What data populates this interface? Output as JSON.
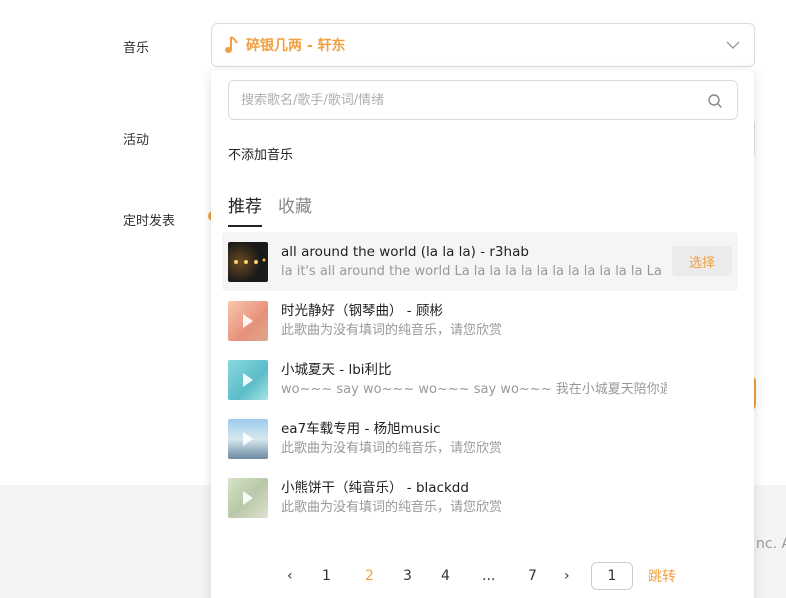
{
  "form": {
    "music_label": "音乐",
    "activity_label": "活动",
    "schedule_label": "定时发表"
  },
  "music_select": {
    "selected": "碎银几两 - 轩东"
  },
  "search": {
    "placeholder": "搜索歌名/歌手/歌词/情绪"
  },
  "no_music": "不添加音乐",
  "tabs": [
    {
      "label": "推荐",
      "active": true
    },
    {
      "label": "收藏",
      "active": false
    }
  ],
  "songs": [
    {
      "title": "all around the world (la la la) - r3hab",
      "sub": " la it's all around the world La la la la la la la la la la la la La la la la la",
      "button": "选择"
    },
    {
      "title": "时光静好（钢琴曲） - 顾彬",
      "sub": "此歌曲为没有填词的纯音乐，请您欣赏"
    },
    {
      "title": "小城夏天 - lbi利比",
      "sub": "wo~~~ say wo~~~ wo~~~ say wo~~~ 我在小城夏天陪你遇见浪漫"
    },
    {
      "title": "ea7车载专用 - 杨旭music",
      "sub": "此歌曲为没有填词的纯音乐，请您欣赏"
    },
    {
      "title": "小熊饼干（纯音乐） - blackdd",
      "sub": "此歌曲为没有填词的纯音乐，请您欣赏"
    }
  ],
  "pagination": {
    "prev": "‹",
    "next": "›",
    "pages": [
      "1",
      "2",
      "3",
      "4",
      "...",
      "7"
    ],
    "current": "2",
    "input_value": "1",
    "jump_label": "跳转"
  },
  "footer": {
    "text": "nc. All"
  },
  "colors": {
    "accent": "#f0a040"
  }
}
